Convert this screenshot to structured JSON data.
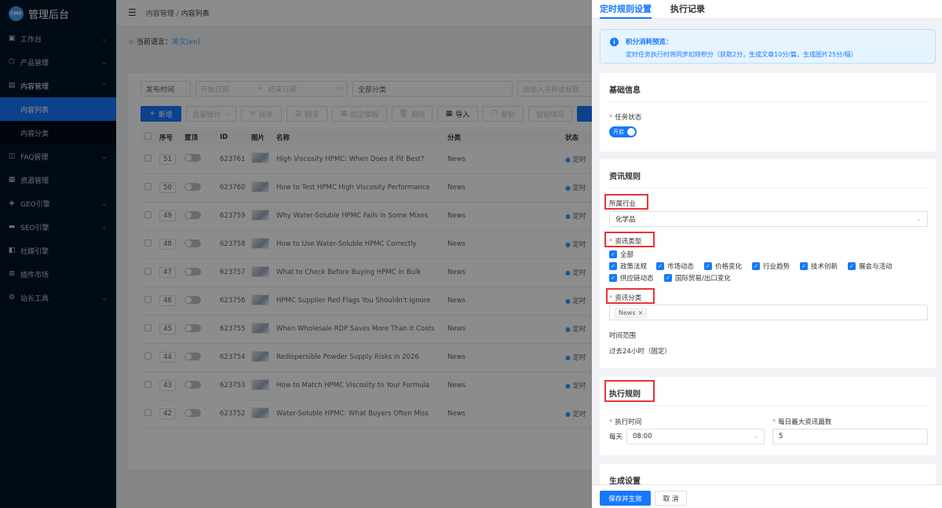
{
  "app": {
    "logo_badge": "CMS",
    "title": "管理后台"
  },
  "sidebar": {
    "items": [
      {
        "label": "工作台",
        "icon": "dashboard-icon"
      },
      {
        "label": "产品管理",
        "icon": "box-icon"
      },
      {
        "label": "内容管理",
        "icon": "document-icon"
      },
      {
        "label": "FAQ管理",
        "icon": "faq-icon"
      },
      {
        "label": "资源管理",
        "icon": "folder-icon"
      },
      {
        "label": "GEO引擎",
        "icon": "geo-icon"
      },
      {
        "label": "SEO引擎",
        "icon": "seo-icon"
      },
      {
        "label": "社媒引擎",
        "icon": "social-icon"
      },
      {
        "label": "插件市场",
        "icon": "plugin-icon"
      },
      {
        "label": "站长工具",
        "icon": "tools-icon"
      }
    ],
    "sub_items": [
      "内容列表",
      "内容分类"
    ]
  },
  "breadcrumb": {
    "parent": "内容管理",
    "sep": "/",
    "current": "内容列表"
  },
  "lang": {
    "label": "当前语言：",
    "value": "英文(en)"
  },
  "filters": {
    "time_type": "发布时间",
    "start_placeholder": "开始日期",
    "arrow": "→",
    "end_placeholder": "结束日期",
    "category": "全部分类",
    "search_placeholder": "请输入名称或标题"
  },
  "toolbar": {
    "new": "新增",
    "batch": "批量操作",
    "sort": "排序",
    "translate": "翻译",
    "template": "指定模板",
    "delete": "删除",
    "import": "导入",
    "copy": "复制",
    "smart": "智能填写"
  },
  "table": {
    "headers": {
      "no": "序号",
      "top": "置顶",
      "id": "ID",
      "image": "图片",
      "name": "名称",
      "category": "分类",
      "status": "状态"
    },
    "rows": [
      {
        "no": "51",
        "id": "623761",
        "name": "High Viscosity HPMC: When Does It Fit Best?",
        "category": "News",
        "status": "定时"
      },
      {
        "no": "50",
        "id": "623760",
        "name": "How to Test HPMC High Viscosity Performance",
        "category": "News",
        "status": "定时"
      },
      {
        "no": "49",
        "id": "623759",
        "name": "Why Water-Soluble HPMC Fails in Some Mixes",
        "category": "News",
        "status": "定时"
      },
      {
        "no": "48",
        "id": "623758",
        "name": "How to Use Water-Soluble HPMC Correctly",
        "category": "News",
        "status": "定时"
      },
      {
        "no": "47",
        "id": "623757",
        "name": "What to Check Before Buying HPMC in Bulk",
        "category": "News",
        "status": "定时"
      },
      {
        "no": "46",
        "id": "623756",
        "name": "HPMC Supplier Red Flags You Shouldn't Ignore",
        "category": "News",
        "status": "定时"
      },
      {
        "no": "45",
        "id": "623755",
        "name": "When Wholesale RDP Saves More Than It Costs",
        "category": "News",
        "status": "定时"
      },
      {
        "no": "44",
        "id": "623754",
        "name": "Redispersible Powder Supply Risks in 2026",
        "category": "News",
        "status": "定时"
      },
      {
        "no": "43",
        "id": "623753",
        "name": "How to Match HPMC Viscosity to Your Formula",
        "category": "News",
        "status": "定时"
      },
      {
        "no": "42",
        "id": "623752",
        "name": "Water-Soluble HPMC: What Buyers Often Miss",
        "category": "News",
        "status": "定时"
      }
    ]
  },
  "drawer": {
    "tabs": [
      "定时规则设置",
      "执行记录"
    ],
    "notice": {
      "title": "积分消耗预览：",
      "text": "定时任务执行时将同步扣除积分（获取2分，生成文章10分/篇，生成图片25分/幅）"
    },
    "basic": {
      "title": "基础信息",
      "status_label": "任务状态",
      "status_value": "开启"
    },
    "news": {
      "title": "资讯规则",
      "industry_label": "所属行业",
      "industry_value": "化学品",
      "type_label": "资讯类型",
      "types": [
        "全部",
        "政策法规",
        "市场动态",
        "价格变化",
        "行业趋势",
        "技术创新",
        "展会与活动",
        "供应链动态",
        "国际贸易/出口变化"
      ],
      "category_label": "资讯分类",
      "category_tag": "News",
      "time_label": "时间范围",
      "time_value": "过去24小时（固定）"
    },
    "exec": {
      "title": "执行规则",
      "time_label": "执行时间",
      "daily": "每天",
      "time_value": "08:00",
      "max_label": "每日最大资讯篇数",
      "max_value": "5"
    },
    "gen": {
      "title": "生成设置"
    },
    "footer": {
      "save": "保存并生效",
      "cancel": "取 消"
    }
  },
  "colors": {
    "primary": "#1677ff",
    "sidebar_bg": "#001529",
    "highlight_box": "#e5343a"
  }
}
